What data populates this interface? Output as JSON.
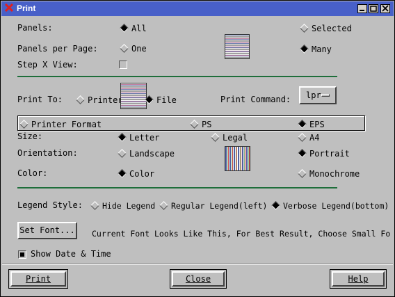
{
  "window": {
    "title": "Print",
    "controls": [
      "minimize",
      "maximize",
      "close"
    ]
  },
  "panels": {
    "label": "Panels:",
    "options": [
      "All",
      "Selected"
    ],
    "selected": "All"
  },
  "panels_per_page": {
    "label": "Panels per Page:",
    "options": [
      "One",
      "Many"
    ],
    "selected": "Many"
  },
  "step_x_view": {
    "label": "Step X View:"
  },
  "print_to": {
    "label": "Print To:",
    "options": [
      "Printer",
      "File"
    ],
    "selected": "File"
  },
  "print_command": {
    "label": "Print Command:",
    "value": "lpr"
  },
  "format": {
    "options": [
      "Printer Format",
      "PS",
      "EPS"
    ],
    "selected": "EPS"
  },
  "size": {
    "label": "Size:",
    "options": [
      "Letter",
      "Legal",
      "A4"
    ],
    "selected": "Letter"
  },
  "orientation": {
    "label": "Orientation:",
    "options": [
      "Landscape",
      "Portrait"
    ],
    "selected": "Portrait"
  },
  "color": {
    "label": "Color:",
    "options": [
      "Color",
      "Monochrome"
    ],
    "selected": "Color"
  },
  "legend": {
    "label": "Legend Style:",
    "options": [
      "Hide Legend",
      "Regular Legend(left)",
      "Verbose Legend(bottom)"
    ],
    "selected": "Verbose Legend(bottom)"
  },
  "font": {
    "button": "Set Font...",
    "preview": "Current Font Looks Like This, For Best Result, Choose Small Fo"
  },
  "show_date_time": {
    "label": "Show Date & Time",
    "checked": true
  },
  "footer": {
    "print": "Print",
    "close": "Close",
    "help": "Help"
  },
  "colors": {
    "titlebar": "#4860c8",
    "background": "#bfbfbf",
    "separator": "#1e6e3a"
  }
}
